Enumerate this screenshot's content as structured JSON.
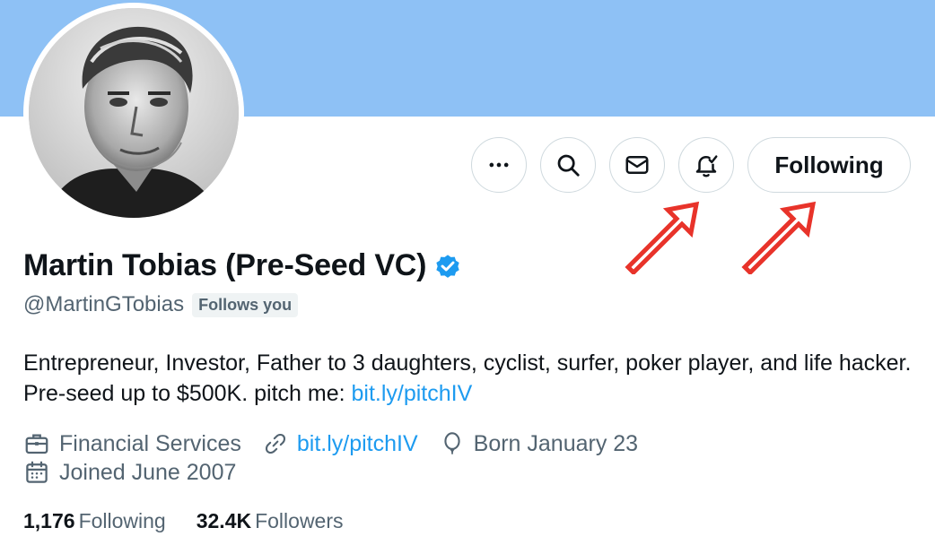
{
  "profile": {
    "display_name": "Martin Tobias (Pre-Seed VC)",
    "handle": "@MartinGTobias",
    "follows_you_badge": "Follows you",
    "bio_text": "Entrepreneur, Investor, Father to 3 daughters, cyclist, surfer, poker player, and life hacker. Pre-seed up to $500K. pitch me: ",
    "bio_link": "bit.ly/pitchIV",
    "category": "Financial Services",
    "website": "bit.ly/pitchIV",
    "birthday": "Born January 23",
    "joined": "Joined June 2007",
    "following_count": "1,176",
    "following_label": "Following",
    "followers_count": "32.4K",
    "followers_label": "Followers"
  },
  "actions": {
    "more_icon": "more-horizontal-icon",
    "search_icon": "search-icon",
    "message_icon": "envelope-icon",
    "notify_icon": "bell-check-icon",
    "following_label": "Following"
  },
  "annotations": {
    "arrow_color": "#e8332a",
    "arrow_icon": "red-outline-arrow"
  },
  "colors": {
    "banner": "#8ec1f5",
    "link": "#1d9bf0",
    "verified": "#1d9bf0",
    "secondary_text": "#536471"
  }
}
